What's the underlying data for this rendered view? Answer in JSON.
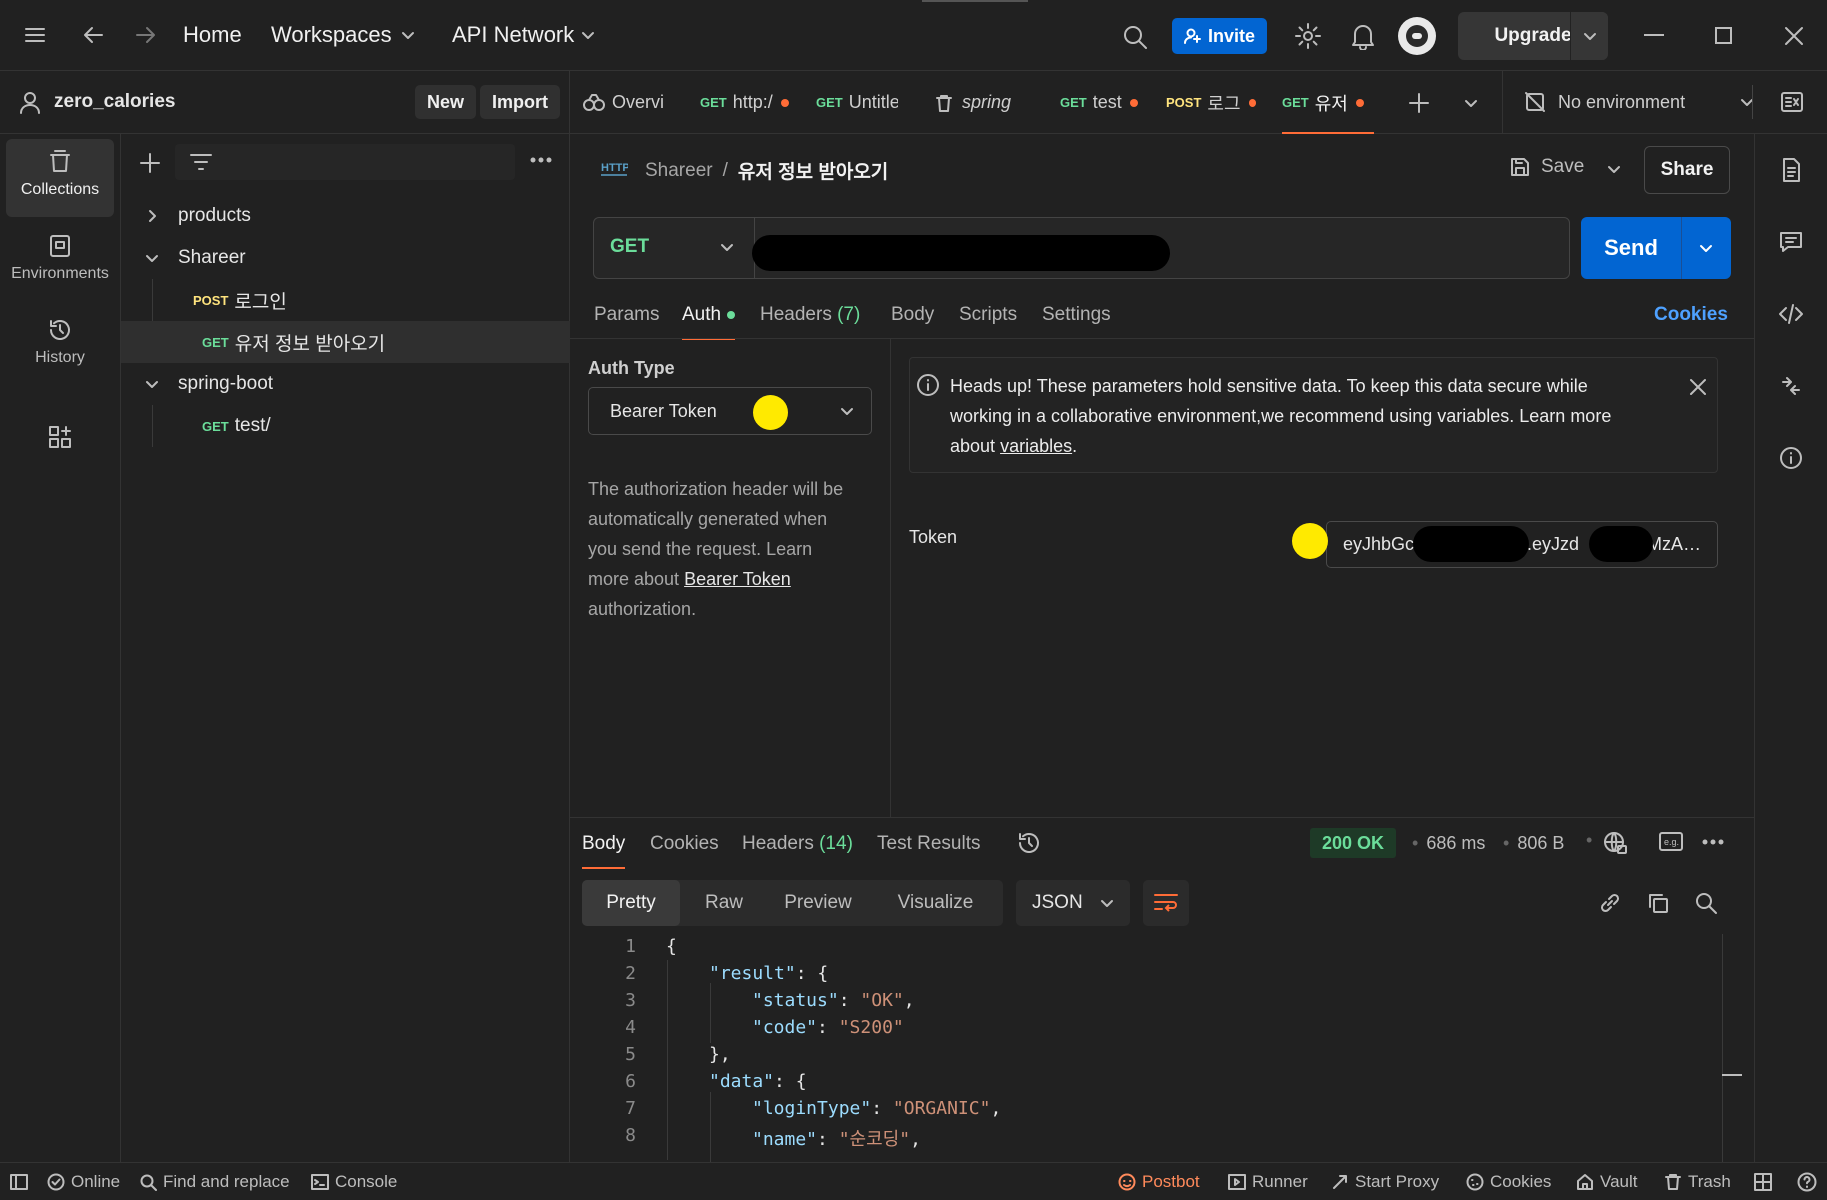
{
  "topbar": {
    "home": "Home",
    "workspaces": "Workspaces",
    "api_network": "API Network",
    "invite": "Invite",
    "upgrade": "Upgrade"
  },
  "workspace": {
    "name": "zero_calories",
    "new_label": "New",
    "import_label": "Import"
  },
  "tabs": [
    {
      "method": "",
      "label": "Overvi",
      "dirty": false
    },
    {
      "method": "GET",
      "label": "http:/",
      "dirty": true
    },
    {
      "method": "GET",
      "label": "Untitle",
      "dirty": false
    },
    {
      "method": "",
      "label": "spring",
      "dirty": false
    },
    {
      "method": "GET",
      "label": "test",
      "dirty": true
    },
    {
      "method": "POST",
      "label": "로그",
      "dirty": true
    },
    {
      "method": "GET",
      "label": "유저 ",
      "dirty": true
    }
  ],
  "environment": {
    "label": "No environment"
  },
  "rail": [
    {
      "label": "Collections",
      "icon": "collections-icon"
    },
    {
      "label": "Environments",
      "icon": "environments-icon"
    },
    {
      "label": "History",
      "icon": "history-icon"
    }
  ],
  "tree": {
    "items": [
      {
        "label": "products",
        "type": "folder"
      },
      {
        "label": "Shareer",
        "type": "folder"
      },
      {
        "method": "POST",
        "label": "로그인"
      },
      {
        "method": "GET",
        "label": "유저 정보 받아오기"
      },
      {
        "label": "spring-boot",
        "type": "folder"
      },
      {
        "method": "GET",
        "label": "test/"
      }
    ]
  },
  "request": {
    "breadcrumb_parent": "Shareer",
    "breadcrumb_sep": "/",
    "title": "유저 정보 받아오기",
    "save": "Save",
    "share": "Share",
    "method": "GET",
    "send": "Send",
    "tabs": {
      "params": "Params",
      "auth": "Auth",
      "headers": "Headers",
      "headers_count": "(7)",
      "body": "Body",
      "scripts": "Scripts",
      "settings": "Settings",
      "cookies": "Cookies"
    },
    "auth": {
      "type_label": "Auth Type",
      "type_value": "Bearer Token",
      "desc_1": "The authorization header will be",
      "desc_2": "automatically generated when",
      "desc_3": "you send the request. Learn",
      "desc_4": "more about",
      "desc_link": "Bearer Token",
      "desc_5": "authorization.",
      "notice_1": "Heads up! These parameters hold sensitive data. To keep this data secure while",
      "notice_2": "working in a collaborative environment,we recommend using variables. Learn more",
      "notice_3": "about",
      "notice_link": "variables",
      "notice_end": ".",
      "token_label": "Token",
      "token_a": "eyJhbGc",
      "token_b": ".eyJzd",
      "token_c": "MzA…"
    }
  },
  "response": {
    "tabs": {
      "body": "Body",
      "cookies": "Cookies",
      "headers": "Headers",
      "headers_count": "(14)",
      "test_results": "Test Results"
    },
    "status": "200 OK",
    "time": "686 ms",
    "size": "806 B",
    "view_modes": [
      "Pretty",
      "Raw",
      "Preview",
      "Visualize"
    ],
    "format": "JSON",
    "lines": [
      "1",
      "2",
      "3",
      "4",
      "5",
      "6",
      "7",
      "8"
    ]
  },
  "statusbar": {
    "online": "Online",
    "find_replace": "Find and replace",
    "console": "Console",
    "postbot": "Postbot",
    "runner": "Runner",
    "start_proxy": "Start Proxy",
    "cookies": "Cookies",
    "vault": "Vault",
    "trash": "Trash"
  },
  "colors": {
    "accent": "#ff6c37",
    "primary": "#0265d2",
    "get": "#6bdd9a",
    "post": "#ffe47e",
    "status_ok": "#6bdd9a"
  }
}
